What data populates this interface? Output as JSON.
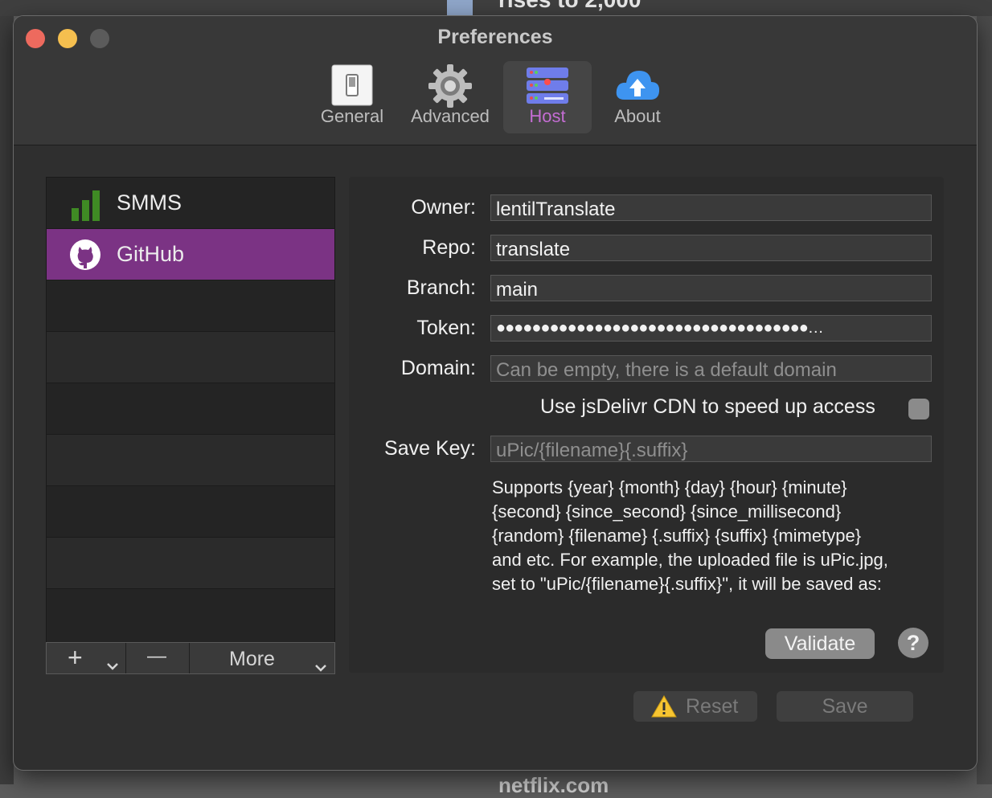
{
  "background": {
    "top_text": "rises to 2,000",
    "bottom_text": "netflix.com"
  },
  "window": {
    "title": "Preferences"
  },
  "toolbar": {
    "items": [
      {
        "label": "General",
        "icon": "switch-icon",
        "active": false
      },
      {
        "label": "Advanced",
        "icon": "gear-icon",
        "active": false
      },
      {
        "label": "Host",
        "icon": "server-icon",
        "active": true
      },
      {
        "label": "About",
        "icon": "cloud-upload-icon",
        "active": false
      }
    ]
  },
  "hosts": {
    "items": [
      {
        "name": "SMMS",
        "icon": "signal-bars-icon",
        "selected": false
      },
      {
        "name": "GitHub",
        "icon": "github-icon",
        "selected": true
      }
    ],
    "toolbar": {
      "add": "+",
      "remove": "—",
      "more": "More"
    }
  },
  "form": {
    "owner": {
      "label": "Owner:",
      "value": "lentilTranslate"
    },
    "repo": {
      "label": "Repo:",
      "value": "translate"
    },
    "branch": {
      "label": "Branch:",
      "value": "main"
    },
    "token": {
      "label": "Token:",
      "value": "●●●●●●●●●●●●●●●●●●●●●●●●●●●●●●●●●●●…"
    },
    "domain": {
      "label": "Domain:",
      "value": "",
      "placeholder": "Can be empty, there is a default domain"
    },
    "cdn": {
      "label": "Use jsDelivr CDN to speed up access",
      "checked": false
    },
    "save_key": {
      "label": "Save Key:",
      "value": "",
      "placeholder": "uPic/{filename}{.suffix}"
    },
    "help_lines": [
      "Supports {year} {month} {day} {hour} {minute}",
      "{second} {since_second} {since_millisecond}",
      "{random} {filename} {.suffix} {suffix} {mimetype}",
      "and etc. For example, the uploaded file is uPic.jpg,",
      "set to \"uPic/{filename}{.suffix}\", it will be saved as:"
    ],
    "validate_label": "Validate",
    "help_label": "?"
  },
  "footer": {
    "reset_label": "Reset",
    "save_label": "Save"
  },
  "colors": {
    "accent": "#7b3384",
    "active_tab_text": "#c46dd3"
  }
}
